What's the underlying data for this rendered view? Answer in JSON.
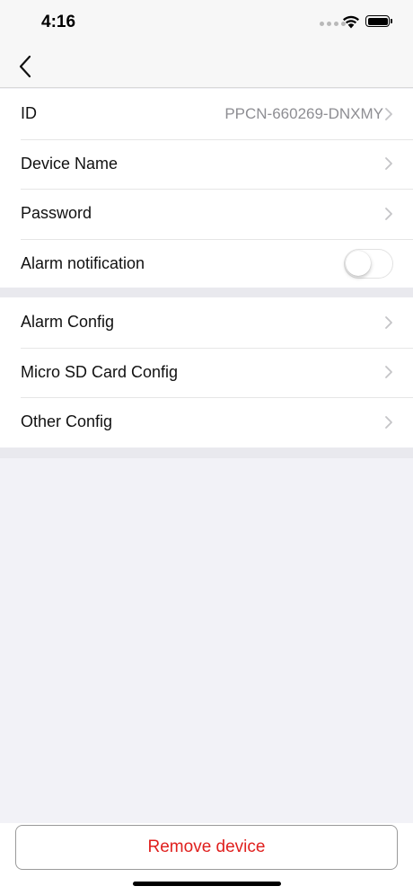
{
  "status_bar": {
    "time": "4:16",
    "icons": [
      "signal-dots-icon",
      "wifi-icon",
      "battery-icon"
    ]
  },
  "nav": {
    "back_icon": "chevron-left-icon"
  },
  "settings_group_1": [
    {
      "label": "ID",
      "value": "PPCN-660269-DNXMY",
      "accessory": "chevron-right-icon"
    },
    {
      "label": "Device Name",
      "accessory": "chevron-right-icon"
    },
    {
      "label": "Password",
      "accessory": "chevron-right-icon"
    },
    {
      "label": "Alarm notification",
      "accessory": "toggle",
      "toggle_on": false
    }
  ],
  "settings_group_2": [
    {
      "label": "Alarm Config",
      "accessory": "chevron-right-icon"
    },
    {
      "label": "Micro SD Card Config",
      "accessory": "chevron-right-icon"
    },
    {
      "label": "Other Config",
      "accessory": "chevron-right-icon"
    }
  ],
  "footer": {
    "remove_label": "Remove device"
  },
  "colors": {
    "destructive": "#e0201e",
    "background": "#f2f2f7",
    "secondary_text": "#8e8e93",
    "chevron": "#c4c4c7"
  }
}
